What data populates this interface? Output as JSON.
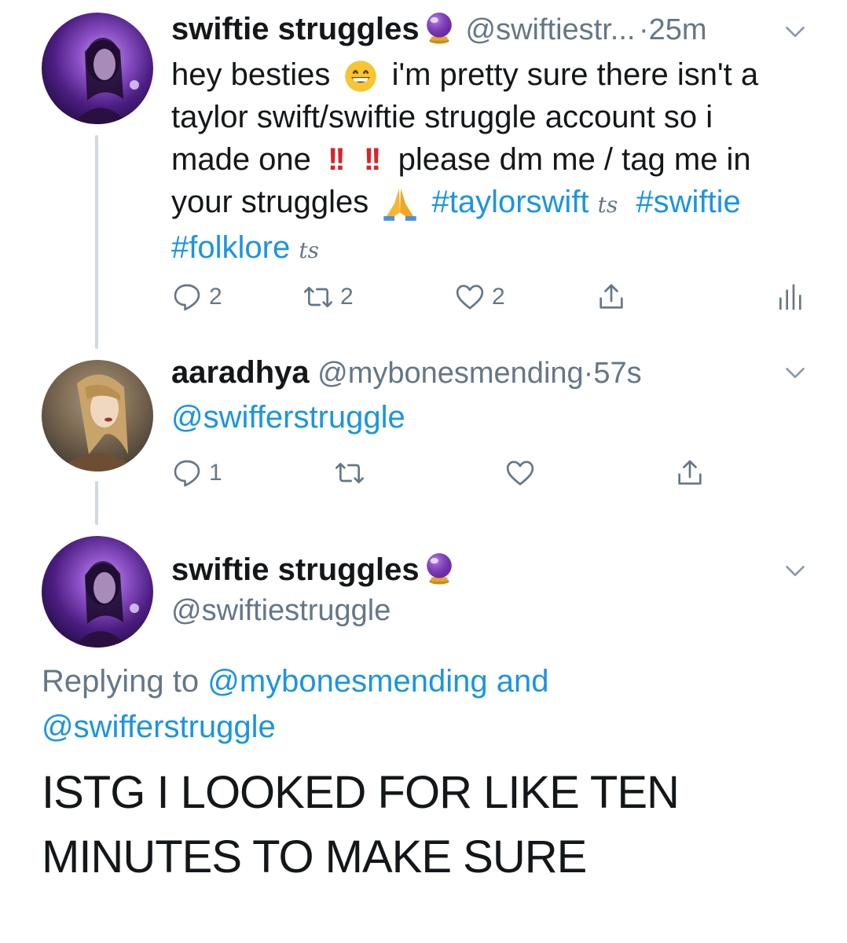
{
  "tweet1": {
    "name": "swiftie struggles",
    "handle": "@swiftiestr...",
    "time": "25m",
    "line1": "hey besties",
    "line1b": "i'm pretty sure there isn't a",
    "line2": "taylor swift/swiftie struggle account so i",
    "line3a": "made one",
    "exclaim1": "!!",
    "exclaim2": "!!",
    "line3b": "please dm me / tag me in",
    "line4a": "your struggles",
    "hashtag1": "#taylorswift",
    "hashtag2": "#swiftie",
    "hashtag3": "#folklore",
    "ts_badge": "ts",
    "replies": "2",
    "retweets": "2",
    "likes": "2"
  },
  "tweet2": {
    "name": "aaradhya",
    "handle": "@mybonesmending",
    "time": "57s",
    "text": "@swifferstruggle",
    "replies": "1"
  },
  "tweet3": {
    "name": "swiftie struggles",
    "handle": "@swiftiestruggle",
    "reply_label": "Replying to",
    "reply_user1": "@mybonesmending",
    "reply_and": "and",
    "reply_user2": "@swifferstruggle",
    "text_line1": "ISTG I LOOKED FOR LIKE TEN",
    "text_line2": "MINUTES TO MAKE SURE"
  },
  "icons": [
    "crystal-ball-icon",
    "grinning-face-icon",
    "folded-hands-icon",
    "reply-icon",
    "retweet-icon",
    "like-icon",
    "share-icon",
    "analytics-icon",
    "chevron-down-icon"
  ],
  "colors": {
    "link": "#1b95e0",
    "muted": "#657786",
    "text": "#14171a",
    "red": "#d8232a"
  }
}
